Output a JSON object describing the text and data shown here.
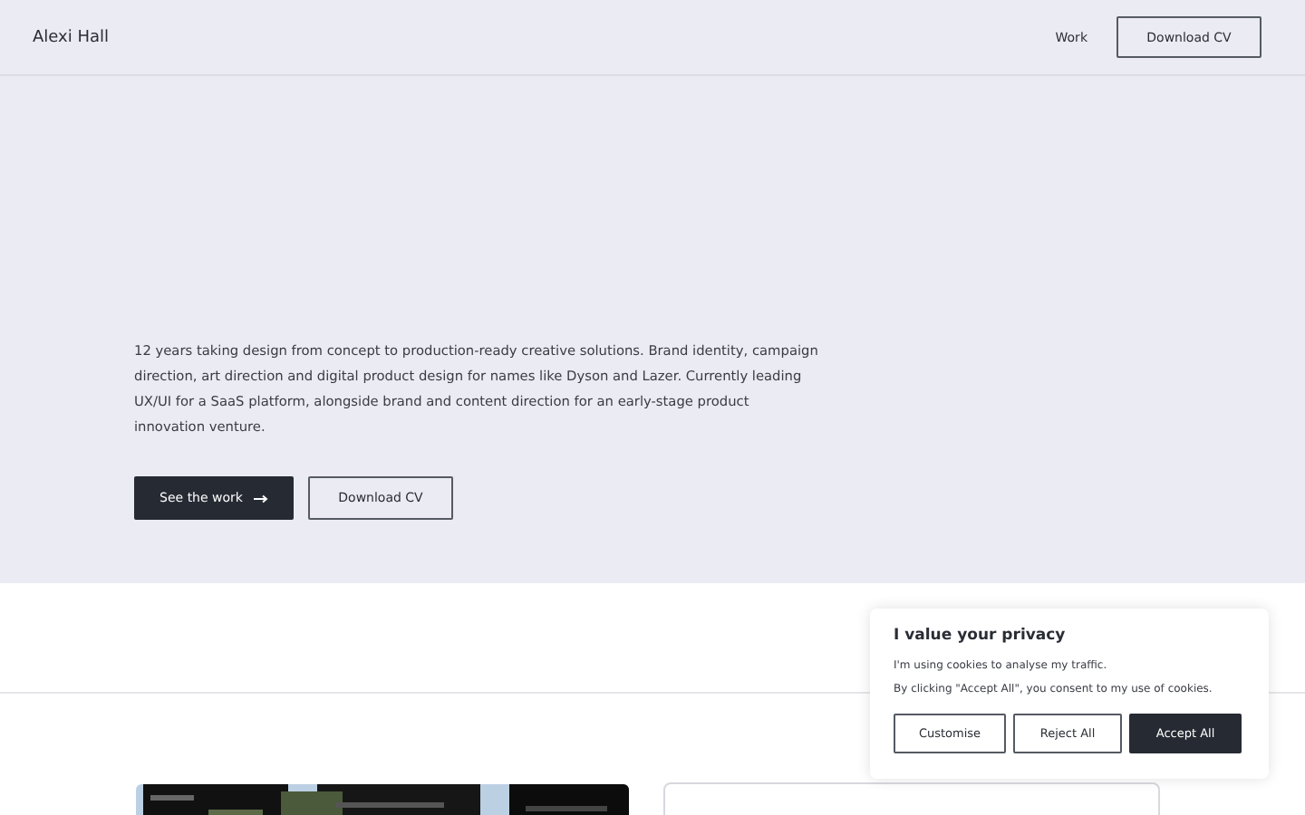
{
  "header": {
    "name": "Alexi Hall",
    "nav": [
      "Work"
    ],
    "cta": "Download CV"
  },
  "hero": {
    "intro": "12 years taking design from concept to production-ready creative solutions. Brand identity, campaign direction, art direction and digital product design for names like Dyson and Lazer. Currently leading UX/UI for a SaaS platform, alongside brand and content direction for an early-stage product innovation venture.",
    "buttons": [
      {
        "kind": "primary",
        "label": "See the work",
        "arrow": true
      },
      {
        "kind": "outline",
        "label": "Download CV",
        "arrow": false
      }
    ]
  },
  "work_cards": [
    {
      "kind": "picture"
    },
    {
      "kind": "blank"
    }
  ],
  "cookie_banner": {
    "title": "I value your privacy",
    "lines": [
      "I'm using cookies to analyse my traffic.",
      "By clicking \"Accept All\", you consent to my use of cookies."
    ],
    "buttons": [
      {
        "kind": "outline",
        "label": "Customise"
      },
      {
        "kind": "outline",
        "label": "Reject All"
      },
      {
        "kind": "primary",
        "label": "Accept All"
      }
    ]
  }
}
